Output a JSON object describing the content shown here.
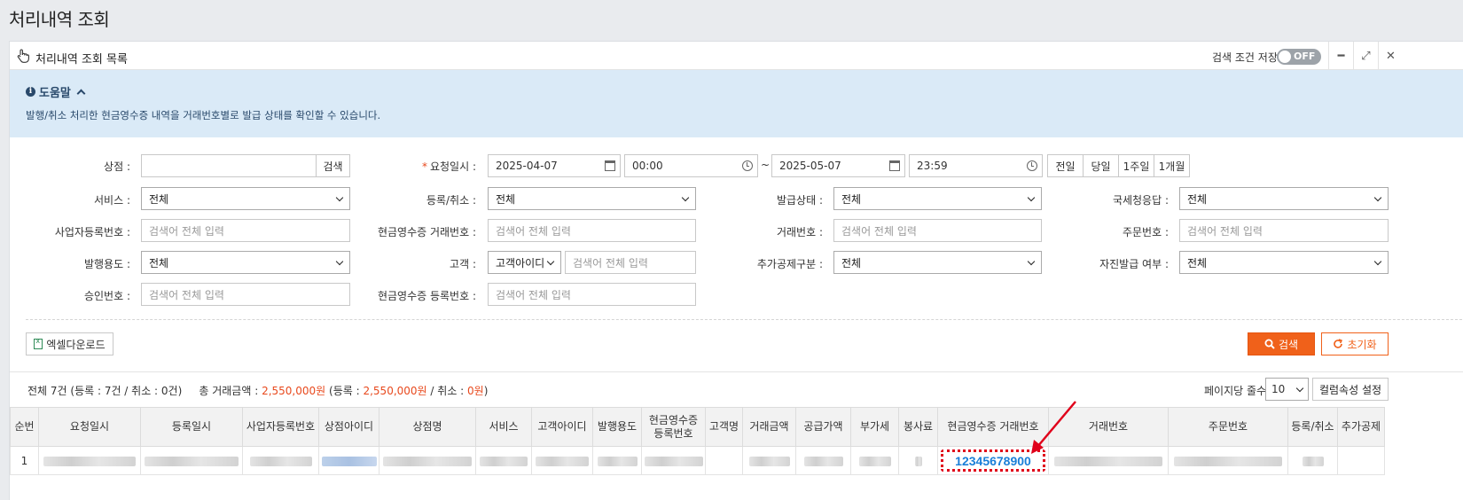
{
  "page": {
    "title": "처리내역 조회"
  },
  "panel": {
    "title": "처리내역 조회 목록",
    "save_condition_label": "검색 조건 저장",
    "toggle_state": "OFF"
  },
  "help": {
    "title": "도움말",
    "text": "발행/취소 처리한 현금영수증 내역을 거래번호별로 발급 상태를 확인할 수 있습니다."
  },
  "filters": {
    "store_label": "상점 :",
    "store_search_btn": "검색",
    "request_date_label": "요청일시 :",
    "date_from": "2025-04-07",
    "time_from": "00:00",
    "tilde": "~",
    "date_to": "2025-05-07",
    "time_to": "23:59",
    "quick_ranges": [
      "전일",
      "당일",
      "1주일",
      "1개월"
    ],
    "service_label": "서비스 :",
    "service_value": "전체",
    "reg_cancel_label": "등록/취소 :",
    "reg_cancel_value": "전체",
    "issue_status_label": "발급상태 :",
    "issue_status_value": "전체",
    "nts_response_label": "국세청응답 :",
    "nts_response_value": "전체",
    "biz_no_label": "사업자등록번호 :",
    "receipt_tx_no_label": "현금영수증 거래번호 :",
    "tx_no_label": "거래번호 :",
    "order_no_label": "주문번호 :",
    "placeholder": "검색어 전체 입력",
    "issue_purpose_label": "발행용도 :",
    "issue_purpose_value": "전체",
    "customer_label": "고객 :",
    "customer_type_value": "고객아이디",
    "extra_deduction_label": "추가공제구분 :",
    "extra_deduction_value": "전체",
    "self_issue_label": "자진발급 여부 :",
    "self_issue_value": "전체",
    "approval_no_label": "승인번호 :",
    "receipt_reg_no_label": "현금영수증 등록번호 :"
  },
  "actions": {
    "excel_download": "엑셀다운로드",
    "search": "검색",
    "reset": "초기화"
  },
  "summary": {
    "total_part1": "전체 7건 (등록 : 7건 / 취소 : 0건)",
    "amount_label": "총 거래금액 :",
    "amount_total": "2,550,000원",
    "reg_open": "(등록 :",
    "amount_reg": "2,550,000원",
    "cancel_sep": "/ 취소 :",
    "amount_cancel": "0원",
    "close": ")",
    "per_page_label": "페이지당 줄수",
    "per_page_value": "10",
    "column_settings": "컬럼속성 설정"
  },
  "table": {
    "headers": [
      "순번",
      "요청일시",
      "등록일시",
      "사업자등록번호",
      "상점아이디",
      "상점명",
      "서비스",
      "고객아이디",
      "발행용도",
      "현금영수증\n등록번호",
      "고객명",
      "거래금액",
      "공급가액",
      "부가세",
      "봉사료",
      "현금영수증 거래번호",
      "거래번호",
      "주문번호",
      "등록/취소",
      "추가공제"
    ],
    "rows": [
      {
        "no": "1",
        "receipt_tx_no": "12345678900"
      }
    ]
  },
  "colors": {
    "accent_orange": "#f0611a",
    "help_bg": "#daeaf7",
    "highlight_red": "#e0001a",
    "link_blue": "#1a7fd8"
  }
}
